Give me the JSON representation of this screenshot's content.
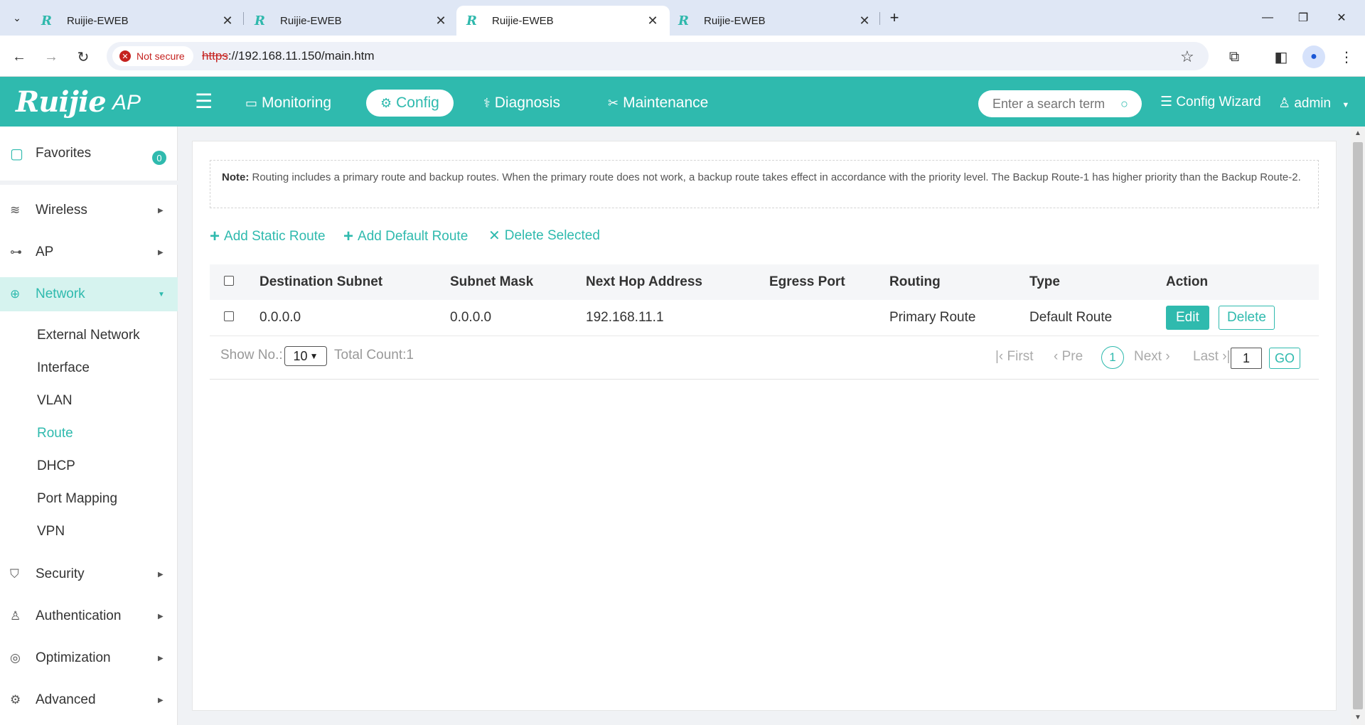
{
  "browser": {
    "tabs": [
      {
        "title": "Ruijie-EWEB",
        "active": false
      },
      {
        "title": "Ruijie-EWEB",
        "active": false
      },
      {
        "title": "Ruijie-EWEB",
        "active": true
      },
      {
        "title": "Ruijie-EWEB",
        "active": false
      }
    ],
    "favicon_text": "R",
    "security_label": "Not secure",
    "url_scheme": "https",
    "url_rest": "://192.168.11.150/main.htm"
  },
  "header": {
    "logo": "Ruijie",
    "product": "AP",
    "nav": [
      {
        "label": "Monitoring",
        "icon": "monitor-icon"
      },
      {
        "label": "Config",
        "icon": "gear-icon"
      },
      {
        "label": "Diagnosis",
        "icon": "stethoscope-icon"
      },
      {
        "label": "Maintenance",
        "icon": "tools-icon"
      }
    ],
    "search_placeholder": "Enter a search term",
    "config_wizard": "Config Wizard",
    "user": "admin"
  },
  "sidebar": {
    "favorites": {
      "label": "Favorites",
      "count": "0"
    },
    "items": [
      {
        "label": "Wireless",
        "icon": "wifi-icon"
      },
      {
        "label": "AP",
        "icon": "ap-icon"
      },
      {
        "label": "Network",
        "icon": "globe-icon"
      },
      {
        "label": "Security",
        "icon": "shield-icon"
      },
      {
        "label": "Authentication",
        "icon": "user-icon"
      },
      {
        "label": "Optimization",
        "icon": "dashboard-icon"
      },
      {
        "label": "Advanced",
        "icon": "settings-icon"
      }
    ],
    "network_sub": [
      "External Network",
      "Interface",
      "VLAN",
      "Route",
      "DHCP",
      "Port Mapping",
      "VPN"
    ]
  },
  "content": {
    "note_label": "Note:",
    "note_text": "Routing includes a primary route and backup routes. When the primary route does not work, a backup route takes effect in accordance with the priority level. The Backup Route-1 has higher priority than the Backup Route-2.",
    "actions": [
      "Add Static Route",
      "Add Default Route",
      "Delete Selected"
    ],
    "table": {
      "headers": [
        "Destination Subnet",
        "Subnet Mask",
        "Next Hop Address",
        "Egress Port",
        "Routing",
        "Type",
        "Action"
      ],
      "rows": [
        {
          "dest": "0.0.0.0",
          "mask": "0.0.0.0",
          "next_hop": "192.168.11.1",
          "egress": "",
          "routing": "Primary Route",
          "type": "Default Route"
        }
      ],
      "edit_label": "Edit",
      "delete_label": "Delete"
    },
    "pager": {
      "show_label": "Show No.:",
      "page_size": "10",
      "total": "Total Count:1",
      "first": "First",
      "pre": "Pre",
      "current": "1",
      "next": "Next",
      "last": "Last",
      "goto_value": "1",
      "go": "GO"
    }
  }
}
